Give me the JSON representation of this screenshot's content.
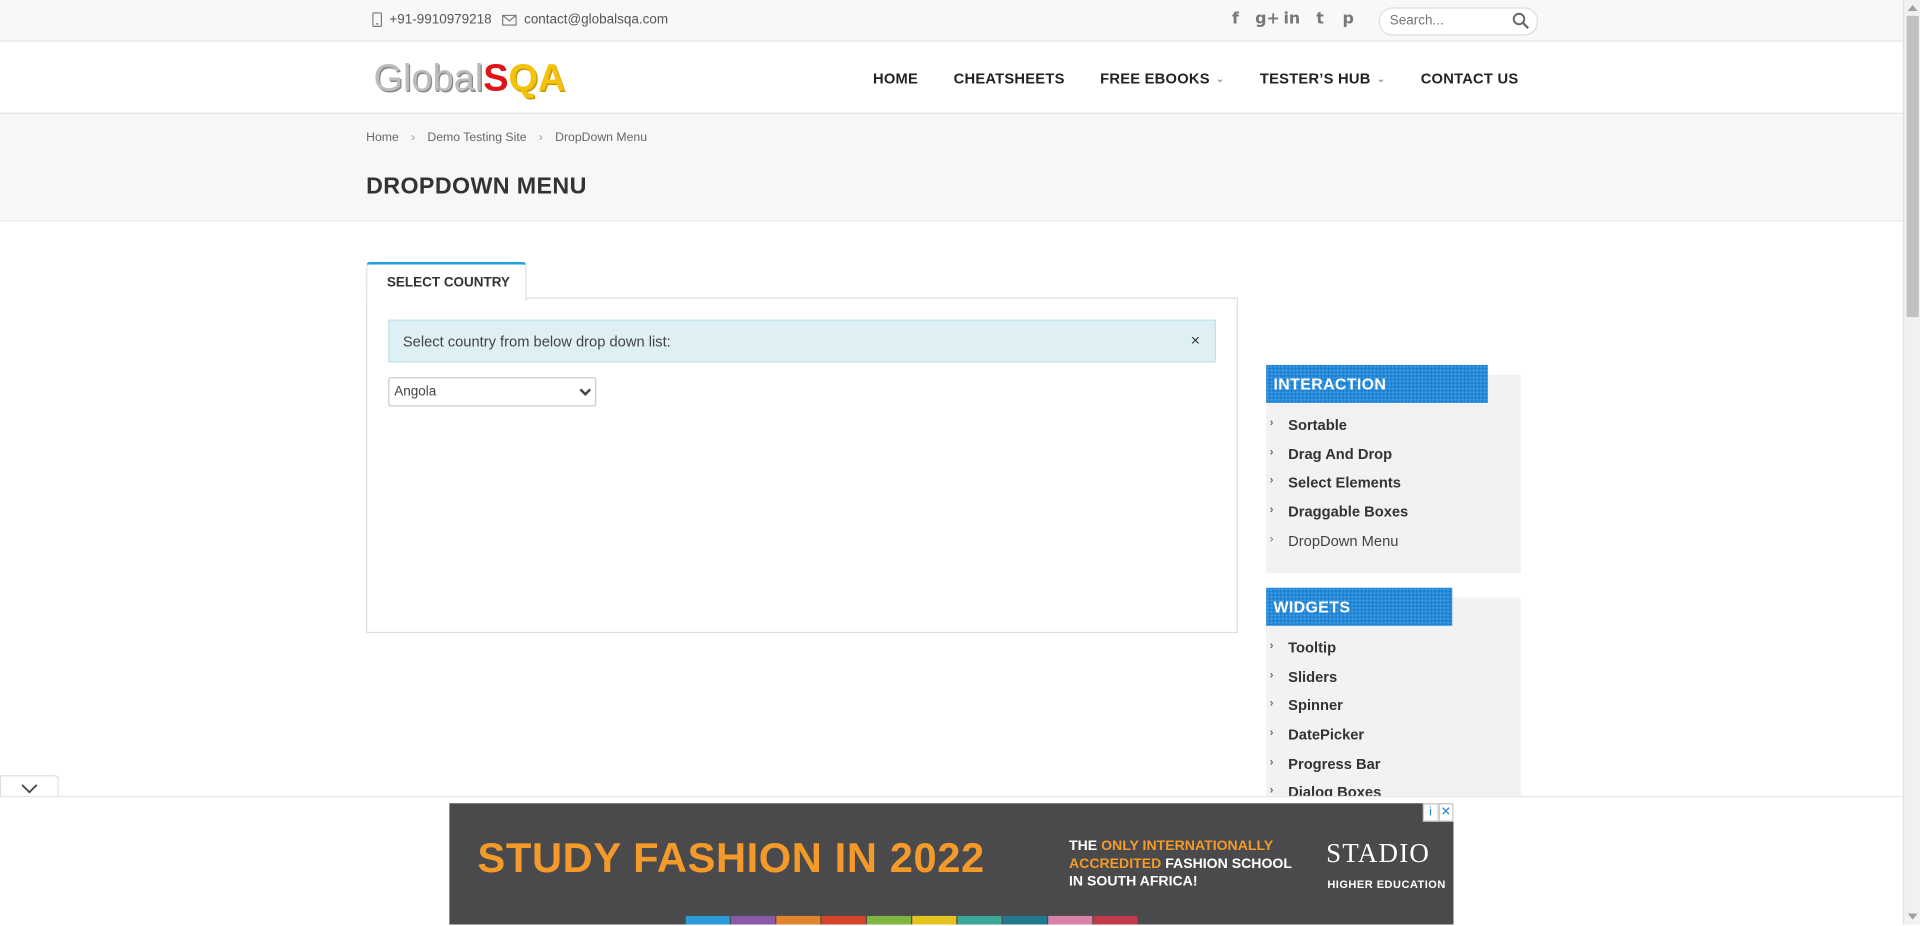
{
  "topbar": {
    "phone": "+91-9910979218",
    "email": "contact@globalsqa.com",
    "social": [
      {
        "icon": "facebook-icon",
        "glyph": "f"
      },
      {
        "icon": "google-plus-icon",
        "glyph": "g+"
      },
      {
        "icon": "linkedin-icon",
        "glyph": "in"
      },
      {
        "icon": "twitter-icon",
        "glyph": "t"
      },
      {
        "icon": "pinterest-icon",
        "glyph": "p"
      }
    ],
    "search_placeholder": "Search..."
  },
  "header": {
    "logo_prefix": "Global",
    "logo_s": "S",
    "logo_qa": "QA",
    "nav": [
      {
        "label": "HOME",
        "dropdown": false
      },
      {
        "label": "CHEATSHEETS",
        "dropdown": false
      },
      {
        "label": "FREE EBOOKS",
        "dropdown": true
      },
      {
        "label": "TESTER’S HUB",
        "dropdown": true
      },
      {
        "label": "CONTACT US",
        "dropdown": false
      }
    ]
  },
  "breadcrumb": [
    "Home",
    "Demo Testing Site",
    "DropDown Menu"
  ],
  "breadcrumb_sep": "›",
  "page_title": "DROPDOWN MENU",
  "tab_label": "SELECT COUNTRY",
  "alert_text": "Select country from below drop down list:",
  "alert_close": "×",
  "country_select": {
    "selected": "Angola"
  },
  "sidebar": {
    "interaction": {
      "title": "INTERACTION",
      "items": [
        "Sortable",
        "Drag And Drop",
        "Select Elements",
        "Draggable Boxes",
        "DropDown Menu"
      ],
      "current": "DropDown Menu"
    },
    "widgets": {
      "title": "WIDGETS",
      "items": [
        "Tooltip",
        "Sliders",
        "Spinner",
        "DatePicker",
        "Progress Bar",
        "Dialog Boxes"
      ]
    }
  },
  "ad": {
    "headline": "STUDY FASHION IN 2022",
    "line1_a": "THE ",
    "line1_b": "ONLY INTERNATIONALLY",
    "line2_a": "ACCREDITED",
    "line2_b": " FASHION SCHOOL",
    "line3": "IN SOUTH AFRICA!",
    "brand": "STADIO",
    "brand_sub": "HIGHER EDUCATION",
    "stripe_colors": [
      "#2a9bd8",
      "#8a5aa8",
      "#e2842a",
      "#d6452b",
      "#7fb642",
      "#e6c21f",
      "#3aa99a",
      "#227a8c",
      "#d882a8",
      "#c23a4a"
    ]
  },
  "colors": {
    "accent": "#1ba1e2",
    "sidebar_header": "#1a82d6",
    "ad_bg": "#4a4a4c",
    "ad_orange": "#f39a2a"
  }
}
